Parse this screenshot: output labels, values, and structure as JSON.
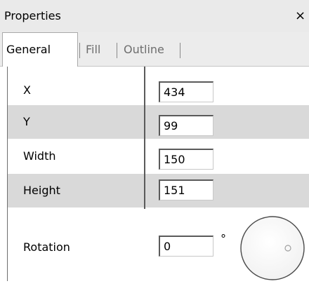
{
  "window": {
    "title": "Properties",
    "close_glyph": "×"
  },
  "tabs": [
    {
      "label": "General",
      "active": true
    },
    {
      "label": "Fill",
      "active": false
    },
    {
      "label": "Outline",
      "active": false
    }
  ],
  "properties": {
    "x": {
      "label": "X",
      "value": "434"
    },
    "y": {
      "label": "Y",
      "value": "99"
    },
    "width": {
      "label": "Width",
      "value": "150"
    },
    "height": {
      "label": "Height",
      "value": "151"
    },
    "rotation": {
      "label": "Rotation",
      "value": "0",
      "unit": "°"
    }
  },
  "icons": {
    "close": "close-icon",
    "rotation_dial": "rotation-dial-icon"
  },
  "colors": {
    "shaded_row": "#d9d9d9",
    "tabstrip": "#ececec",
    "titlebar": "#eaeaea"
  }
}
